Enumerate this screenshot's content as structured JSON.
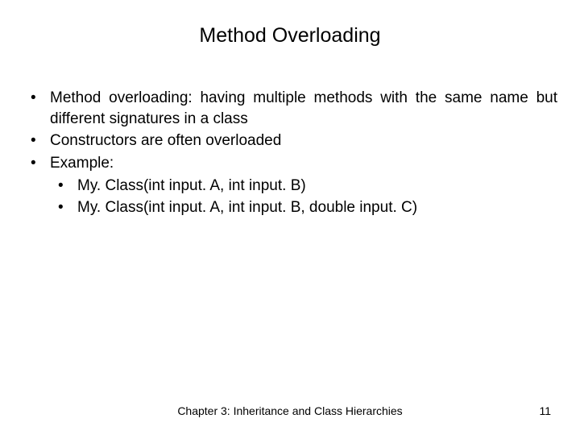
{
  "title": "Method Overloading",
  "bullets": [
    "Method overloading: having multiple methods with the same name but different signatures in a class",
    "Constructors are often overloaded",
    "Example:"
  ],
  "subBullets": [
    "My. Class(int input. A, int input. B)",
    "My. Class(int input. A, int input. B, double input. C)"
  ],
  "footer": "Chapter 3: Inheritance and Class Hierarchies",
  "pageNumber": "11"
}
